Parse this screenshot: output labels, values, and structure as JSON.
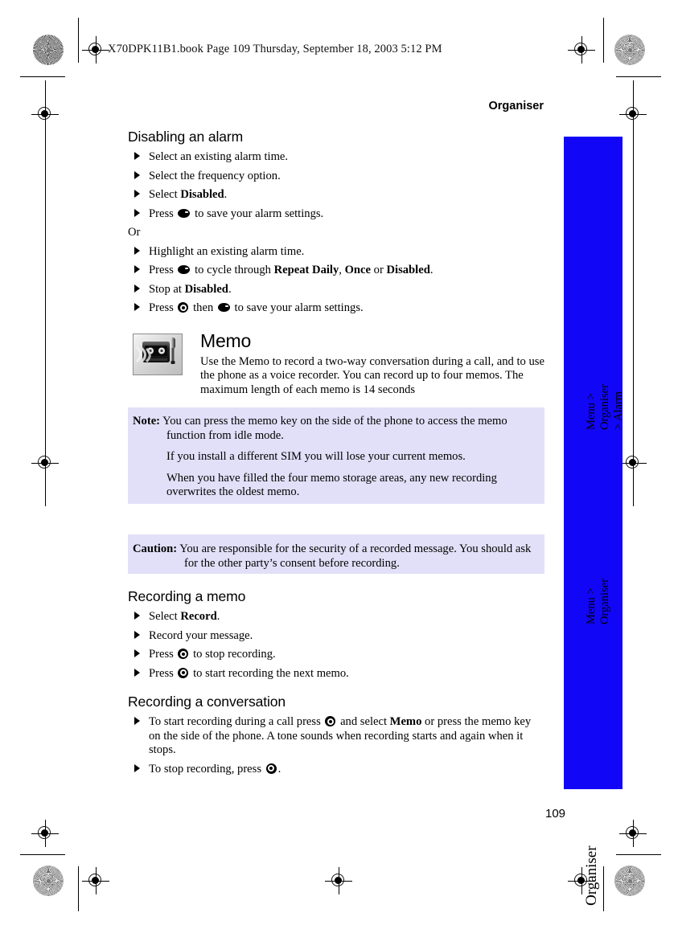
{
  "slug": "X70DPK11B1.book  Page 109  Thursday, September 18, 2003  5:12 PM",
  "running_head": "Organiser",
  "folio": "109",
  "colors": {
    "tab_blue": "#1206F6",
    "callout_bg": "#E2E0F8",
    "text": "#000000"
  },
  "sections": {
    "disabling_alarm": {
      "heading": "Disabling an alarm",
      "steps_before_or": [
        {
          "pre": "Select an existing alarm time.",
          "icon": "",
          "post": ""
        },
        {
          "pre": "Select the frequency option.",
          "icon": "",
          "post": ""
        },
        {
          "pre": "Select ",
          "bold": "Disabled",
          "post": "."
        },
        {
          "pre": "Press ",
          "icon": "softkey-icon",
          "post": " to save your alarm settings."
        }
      ],
      "or_label": "Or",
      "steps_after_or": [
        {
          "pre": "Highlight an existing alarm time.",
          "icon": "",
          "post": ""
        },
        {
          "pre": "Press ",
          "icon": "softkey-icon",
          "post": " to cycle through Repeat Daily, Once or Disabled."
        },
        {
          "pre": "Stop at ",
          "bold": "Disabled",
          "post": "."
        },
        {
          "pre": "Press ",
          "icon": "navkey-icon",
          "post": " then (softkey) to save your alarm settings."
        }
      ],
      "bold_terms": [
        "Disabled",
        "Repeat Daily",
        "Once"
      ]
    },
    "memo": {
      "title": "Memo",
      "icon_name": "cassette-microphone-icon",
      "description": "Use the Memo to record a two-way conversation during a call, and to use the phone as a voice recorder. You can record up to four memos. The maximum length of each memo is 14 seconds"
    },
    "note": {
      "label": "Note:",
      "paragraphs": [
        "You can press the memo key on the side of the phone to access the memo function from idle mode.",
        "If you install a different SIM you will lose your current memos.",
        "When you have filled the four memo storage areas, any new recording overwrites the oldest memo."
      ]
    },
    "caution": {
      "label": "Caution:",
      "paragraphs": [
        "You are responsible for the security of a recorded message. You should ask for the other party’s consent before recording."
      ]
    },
    "recording_memo": {
      "heading": "Recording a memo",
      "steps": [
        {
          "pre": "Select ",
          "bold": "Record",
          "post": "."
        },
        {
          "pre": "Record your message.",
          "post": ""
        },
        {
          "pre": "Press ",
          "icon": "navkey-icon",
          "post": " to stop recording."
        },
        {
          "pre": "Press ",
          "icon": "navkey-icon",
          "post": " to start recording the next memo."
        }
      ]
    },
    "recording_conversation": {
      "heading": "Recording a conversation",
      "steps": [
        {
          "pre": "To start recording during a call press ",
          "icon": "navkey-icon",
          "post": " and select Memo or press the memo key on the side of the phone. A tone sounds when recording starts and again when it stops."
        },
        {
          "pre": "To stop recording, press ",
          "icon": "navkey-icon",
          "post": "."
        }
      ]
    }
  },
  "side_tab": {
    "items": [
      {
        "label": "Menu > Organiser > Alarm",
        "size": "small"
      },
      {
        "label": "Menu > Organiser",
        "size": "small"
      },
      {
        "label": "Organiser",
        "size": "large"
      }
    ]
  }
}
